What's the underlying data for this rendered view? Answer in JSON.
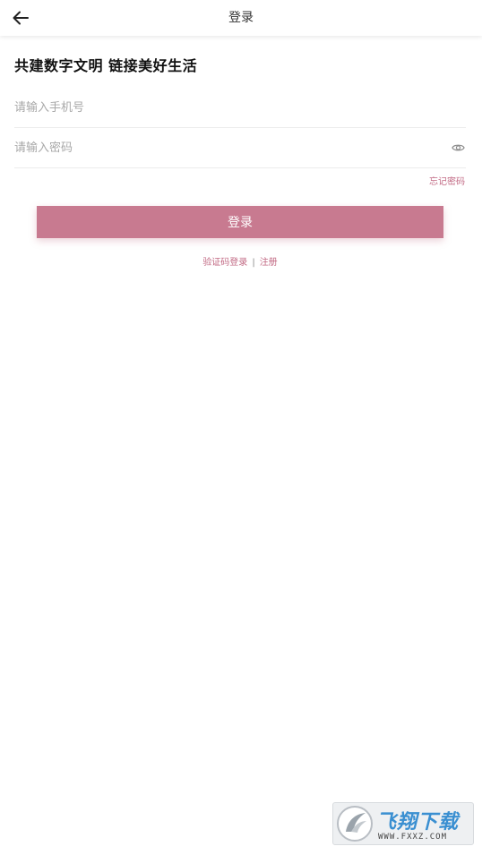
{
  "header": {
    "title": "登录"
  },
  "slogan": "共建数字文明 链接美好生活",
  "form": {
    "phone_placeholder": "请输入手机号",
    "password_placeholder": "请输入密码",
    "forgot_label": "忘记密码",
    "login_label": "登录"
  },
  "links": {
    "sms_login": "验证码登录",
    "separator": "|",
    "register": "注册"
  },
  "watermark": {
    "brand": "飞翔下载",
    "url": "WWW.FXXZ.COM"
  },
  "icons": {
    "back": "arrow-left-icon",
    "eye": "eye-icon"
  },
  "colors": {
    "accent": "#c87a90",
    "link": "#c26a84"
  }
}
